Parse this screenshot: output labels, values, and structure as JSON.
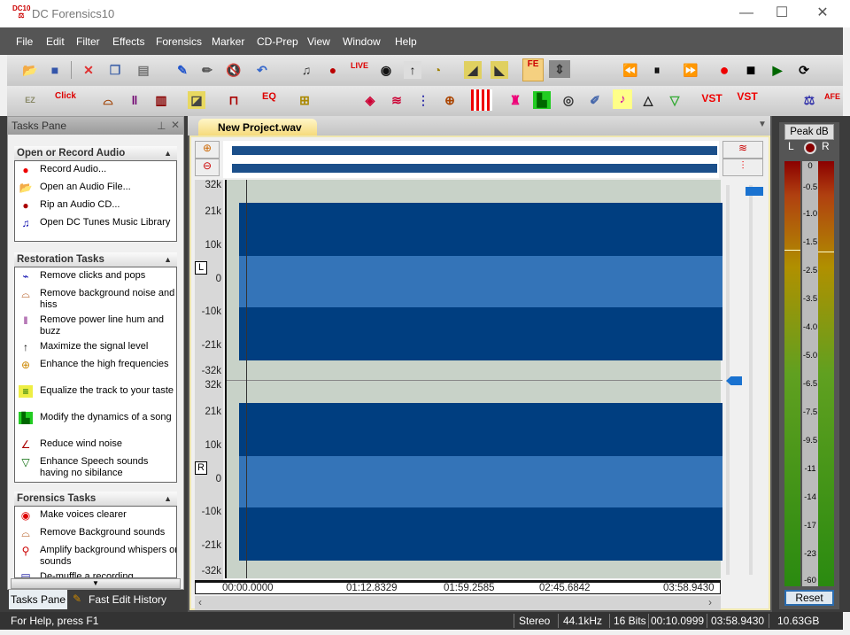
{
  "window": {
    "title": "DC Forensics10",
    "minimize": "—",
    "maximize": "☐",
    "close": "✕"
  },
  "menu": [
    "File",
    "Edit",
    "Filter",
    "Effects",
    "Forensics",
    "Marker",
    "CD-Prep",
    "View",
    "Window",
    "Help"
  ],
  "toolbar1": {
    "icons": [
      "open-folder-icon",
      "save-icon",
      "delete-icon",
      "copy-icon",
      "paste-icon",
      "edit-wave-icon",
      "pencil-icon",
      "mute-icon",
      "undo-icon",
      "dc-tunes-icon",
      "rip-cd-icon",
      "live-icon",
      "burn-cd-icon",
      "maximize-level-icon",
      "timer-icon",
      "fade-in-icon",
      "fade-out-icon",
      "fe-icon",
      "split-icon"
    ],
    "live_label": "LIVE",
    "fe_label": "FE",
    "transport": [
      "rewind-icon",
      "pause-icon",
      "fast-forward-icon",
      "record-icon",
      "stop-icon",
      "play-icon",
      "loop-icon"
    ]
  },
  "toolbar2": {
    "ez_label": "EZ",
    "click_label": "Click",
    "eq_label": "EQ",
    "vst_label": "VST",
    "vst2_label": "VST",
    "afe_label": "AFE",
    "icons": [
      "ez-clean-icon",
      "declick-icon",
      "denoise-icon",
      "dehum-icon",
      "compressor-icon",
      "crossfade-icon",
      "book-icon",
      "eq-icon",
      "routing-icon",
      "effect-star-icon",
      "wind-icon",
      "speech-icon",
      "filter-icon",
      "amp-icon",
      "blender-icon",
      "dynamics-icon",
      "disc-icon",
      "brush-icon",
      "music-note-icon",
      "speech-enhance-icon",
      "dome-icon",
      "vst-icon",
      "vst-plus-minus-icon",
      "ez-scale-icon",
      "afe-icon"
    ]
  },
  "tasks_pane": {
    "title": "Tasks Pane",
    "groups": [
      {
        "title": "Open or Record Audio",
        "items": [
          {
            "icon": "record-icon",
            "label": "Record Audio..."
          },
          {
            "icon": "open-folder-icon",
            "label": "Open an Audio File..."
          },
          {
            "icon": "rip-cd-icon",
            "label": "Rip an Audio CD..."
          },
          {
            "icon": "music-library-icon",
            "label": "Open DC Tunes Music Library"
          }
        ]
      },
      {
        "title": "Restoration Tasks",
        "items": [
          {
            "icon": "declick-icon",
            "label": "Remove clicks and pops"
          },
          {
            "icon": "denoise-icon",
            "label": "Remove background noise and hiss"
          },
          {
            "icon": "dehum-icon",
            "label": "Remove power line hum and buzz"
          },
          {
            "icon": "maximize-level-icon",
            "label": "Maximize the signal level"
          },
          {
            "icon": "high-freq-icon",
            "label": "Enhance the high frequencies"
          },
          {
            "icon": "equalizer-icon",
            "label": "Equalize the track to your taste"
          },
          {
            "icon": "dynamics-icon",
            "label": "Modify the dynamics of a song"
          },
          {
            "icon": "wind-noise-icon",
            "label": "Reduce wind noise"
          },
          {
            "icon": "speech-icon",
            "label": "Enhance Speech sounds having no sibilance"
          }
        ]
      },
      {
        "title": "Forensics Tasks",
        "items": [
          {
            "icon": "lips-icon",
            "label": "Make voices clearer"
          },
          {
            "icon": "denoise-icon",
            "label": "Remove Background sounds"
          },
          {
            "icon": "whisper-icon",
            "label": "Amplify background whispers or sounds"
          },
          {
            "icon": "demuffle-icon",
            "label": "De-muffle a recording"
          }
        ]
      }
    ],
    "tabs": [
      "Tasks Pane",
      "Fast Edit History"
    ]
  },
  "editor": {
    "tab_title": "New Project.wav",
    "channels": [
      "L",
      "R"
    ],
    "y_labels": [
      "32k",
      "21k",
      "10k",
      "0",
      "-10k",
      "-21k",
      "-32k"
    ],
    "time_labels": [
      "00:00.0000",
      "01:12.8329",
      "01:59.2585",
      "02:45.6842",
      "03:58.9430"
    ]
  },
  "meter": {
    "title": "Peak dB",
    "left": "L",
    "right": "R",
    "scale": [
      "0",
      "-0.5",
      "-1.0",
      "-1.5",
      "-2.5",
      "-3.5",
      "-4.0",
      "-5.0",
      "-6.5",
      "-7.5",
      "-9.5",
      "-11",
      "-14",
      "-17",
      "-23",
      "-60"
    ],
    "reset": "Reset"
  },
  "status": {
    "help": "For Help, press F1",
    "channels": "Stereo",
    "rate": "44.1kHz",
    "bits": "16 Bits",
    "position": "00:10.0999",
    "length": "03:58.9430",
    "disk": "10.63GB"
  }
}
